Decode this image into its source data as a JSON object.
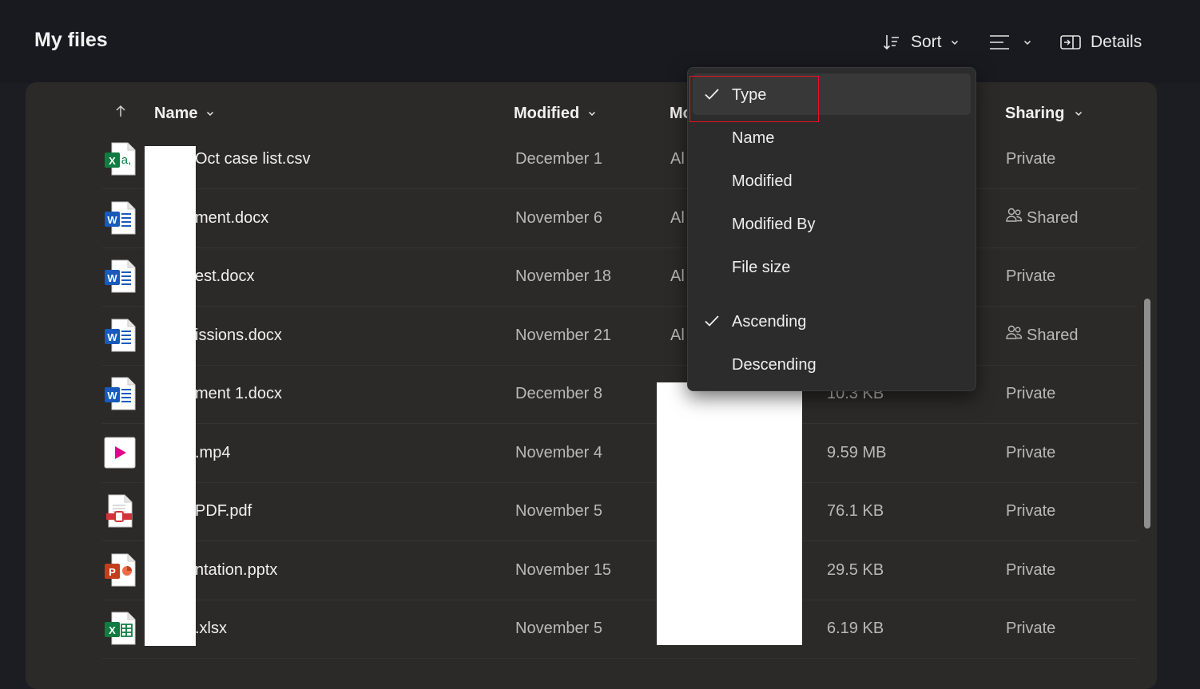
{
  "header": {
    "title": "My files"
  },
  "commands": {
    "sort_label": "Sort",
    "details_label": "Details"
  },
  "columns": {
    "name": "Name",
    "modified": "Modified",
    "modified_by": "Mo",
    "sharing": "Sharing"
  },
  "files": [
    {
      "name": "Oct case list.csv",
      "modified": "December 1",
      "modified_by": "Al",
      "size": "",
      "sharing": "Private",
      "shared": false,
      "icon": "excel-csv-icon"
    },
    {
      "name": "ment.docx",
      "modified": "November 6",
      "modified_by": "Al",
      "size": "",
      "sharing": "Shared",
      "shared": true,
      "icon": "word-icon"
    },
    {
      "name": "est.docx",
      "modified": "November 18",
      "modified_by": "Al",
      "size": "",
      "sharing": "Private",
      "shared": false,
      "icon": "word-icon"
    },
    {
      "name": "issions.docx",
      "modified": "November 21",
      "modified_by": "Al",
      "size": "",
      "sharing": "Shared",
      "shared": true,
      "icon": "word-icon"
    },
    {
      "name": "ment 1.docx",
      "modified": "December 8",
      "modified_by": "",
      "size": "10.3 KB",
      "sharing": "Private",
      "shared": false,
      "icon": "word-icon"
    },
    {
      "name": ".mp4",
      "modified": "November 4",
      "modified_by": "",
      "size": "9.59 MB",
      "sharing": "Private",
      "shared": false,
      "icon": "video-icon"
    },
    {
      "name": "PDF.pdf",
      "modified": "November 5",
      "modified_by": "",
      "size": "76.1 KB",
      "sharing": "Private",
      "shared": false,
      "icon": "pdf-icon"
    },
    {
      "name": "ntation.pptx",
      "modified": "November 15",
      "modified_by": "",
      "size": "29.5 KB",
      "sharing": "Private",
      "shared": false,
      "icon": "powerpoint-icon"
    },
    {
      "name": ".xlsx",
      "modified": "November 5",
      "modified_by": "",
      "size": "6.19 KB",
      "sharing": "Private",
      "shared": false,
      "icon": "excel-icon"
    }
  ],
  "sort_menu": {
    "items": [
      {
        "label": "Type",
        "checked": true
      },
      {
        "label": "Name",
        "checked": false
      },
      {
        "label": "Modified",
        "checked": false
      },
      {
        "label": "Modified By",
        "checked": false
      },
      {
        "label": "File size",
        "checked": false
      }
    ],
    "order": [
      {
        "label": "Ascending",
        "checked": true
      },
      {
        "label": "Descending",
        "checked": false
      }
    ]
  },
  "colors": {
    "background": "#1c1d22",
    "card": "#2b2a28",
    "menu": "#2c2c2c",
    "highlight_border": "#e81123",
    "word_blue": "#185abd",
    "excel_green": "#107c41",
    "powerpoint_orange": "#c43e1c",
    "pdf_red": "#d13438",
    "video_pink": "#e3008c"
  }
}
